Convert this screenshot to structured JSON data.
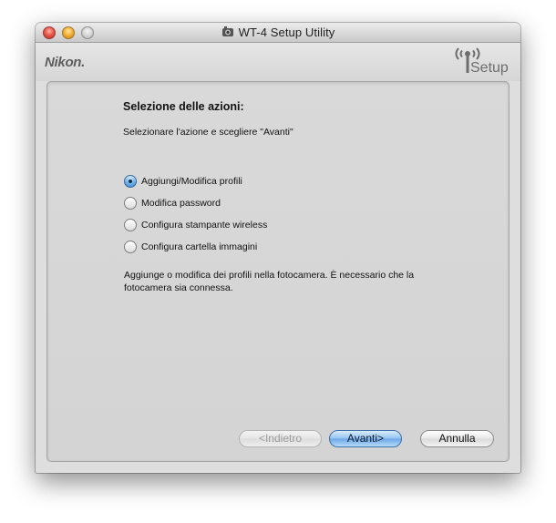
{
  "window": {
    "title": "WT-4 Setup Utility"
  },
  "header": {
    "brand": "Nikon.",
    "setup_label": "Setup"
  },
  "content": {
    "heading": "Selezione delle azioni:",
    "instruction": "Selezionare l'azione e scegliere \"Avanti\"",
    "options": [
      {
        "label": "Aggiungi/Modifica profili",
        "selected": true
      },
      {
        "label": "Modifica password",
        "selected": false
      },
      {
        "label": "Configura stampante wireless",
        "selected": false
      },
      {
        "label": "Configura cartella immagini",
        "selected": false
      }
    ],
    "description": "Aggiunge o modifica dei profili nella fotocamera. È necessario che la fotocamera sia connessa."
  },
  "buttons": {
    "back": {
      "label": "<Indietro",
      "enabled": false
    },
    "next": {
      "label": "Avanti>",
      "default": true
    },
    "cancel": {
      "label": "Annulla"
    }
  },
  "colors": {
    "accent_blue": "#6aa7e6",
    "panel_bg": "#d7d7d7",
    "header_bg": "#dedede"
  }
}
